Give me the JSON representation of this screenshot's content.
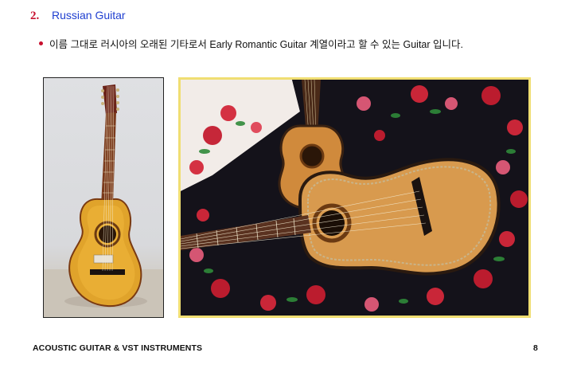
{
  "heading": {
    "number": "2.",
    "title": "Russian Guitar"
  },
  "bullet": {
    "text": "이름 그대로 러시아의 오래된 기타로서 Early Romantic Guitar 계열이라고 할 수 있는 Guitar 입니다."
  },
  "images": [
    {
      "subject": "seven-string russian guitar standing upright"
    },
    {
      "subject": "two russian guitars on floral shawl"
    }
  ],
  "footer": {
    "title": "ACOUSTIC GUITAR & VST INSTRUMENTS",
    "page": "8"
  },
  "colors": {
    "heading_number": "#c8102e",
    "heading_title": "#1f3fd0",
    "bullet_dot": "#c8102e",
    "photo_frame": "#f0de72"
  }
}
